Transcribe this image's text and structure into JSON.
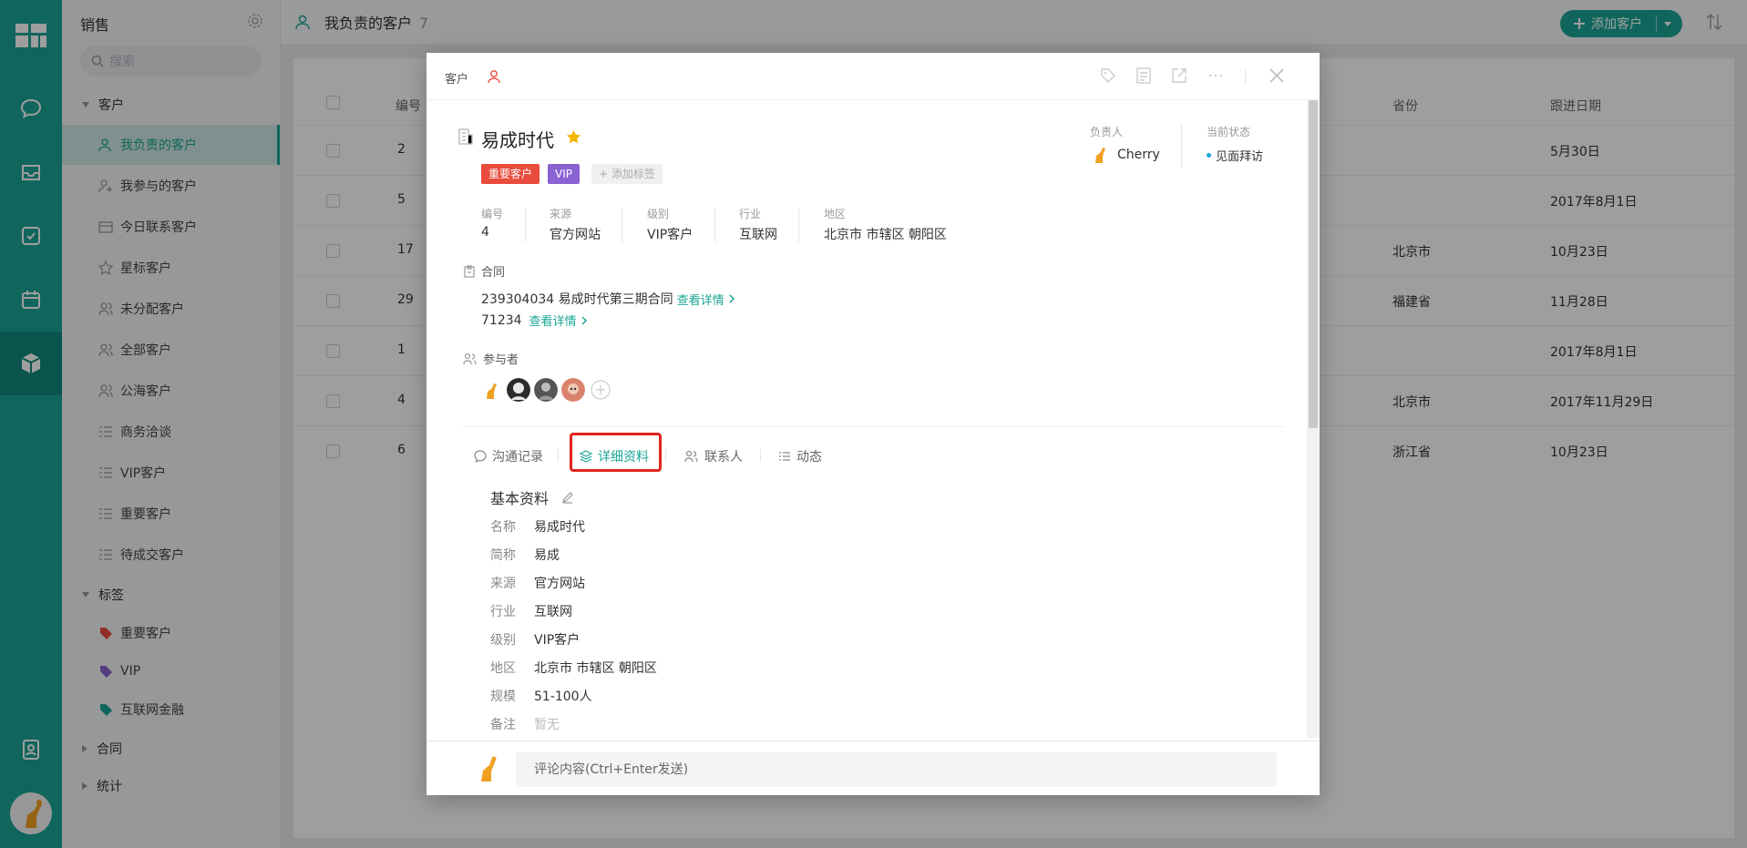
{
  "app": {
    "module_title": "销售",
    "search_placeholder": "搜索"
  },
  "sidebar": {
    "groups": {
      "customer": "客户",
      "tags": "标签",
      "contract": "合同",
      "stats": "统计"
    },
    "items": [
      {
        "label": "我负责的客户",
        "icon": "user-icon",
        "active": true
      },
      {
        "label": "我参与的客户",
        "icon": "user-add-icon"
      },
      {
        "label": "今日联系客户",
        "icon": "calendar-card-icon"
      },
      {
        "label": "星标客户",
        "icon": "star-icon"
      },
      {
        "label": "未分配客户",
        "icon": "users-icon"
      },
      {
        "label": "全部客户",
        "icon": "users-icon"
      },
      {
        "label": "公海客户",
        "icon": "users-icon"
      },
      {
        "label": "商务洽谈",
        "icon": "list-icon"
      },
      {
        "label": "VIP客户",
        "icon": "list-icon"
      },
      {
        "label": "重要客户",
        "icon": "list-icon"
      },
      {
        "label": "待成交客户",
        "icon": "list-icon"
      }
    ],
    "tags": [
      {
        "label": "重要客户",
        "color": "#e94b3c"
      },
      {
        "label": "VIP",
        "color": "#8a63d2"
      },
      {
        "label": "互联网金融",
        "color": "#1aa595"
      }
    ]
  },
  "topbar": {
    "title": "我负责的客户",
    "count": "7",
    "add_button": "添加客户"
  },
  "table": {
    "headers": {
      "id": "编号",
      "province": "省份",
      "follow_date": "跟进日期"
    },
    "rows": [
      {
        "id": "2",
        "province": "",
        "date": "5月30日"
      },
      {
        "id": "5",
        "province": "",
        "date": "2017年8月1日"
      },
      {
        "id": "17",
        "province": "北京市",
        "date": "10月23日"
      },
      {
        "id": "29",
        "province": "福建省",
        "date": "11月28日"
      },
      {
        "id": "1",
        "province": "",
        "date": "2017年8月1日"
      },
      {
        "id": "4",
        "province": "北京市",
        "date": "2017年11月29日"
      },
      {
        "id": "6",
        "province": "浙江省",
        "date": "10月23日"
      }
    ]
  },
  "modal": {
    "crumb": "客户",
    "customer_name": "易成时代",
    "tags": [
      {
        "label": "重要客户",
        "color": "#e94b3c"
      },
      {
        "label": "VIP",
        "color": "#8a63d2"
      }
    ],
    "add_tag": "+ 添加标签",
    "owner_label": "负责人",
    "owner_name": "Cherry",
    "status_label": "当前状态",
    "status_value": "见面拜访",
    "fields": [
      {
        "label": "编号",
        "value": "4"
      },
      {
        "label": "来源",
        "value": "官方网站"
      },
      {
        "label": "级别",
        "value": "VIP客户"
      },
      {
        "label": "行业",
        "value": "互联网"
      },
      {
        "label": "地区",
        "value": "北京市 市辖区 朝阳区"
      }
    ],
    "contract_section": "合同",
    "contracts": [
      {
        "text": "239304034 易成时代第三期合同",
        "link": "查看详情"
      },
      {
        "text": "71234",
        "link": "查看详情"
      }
    ],
    "participants_section": "参与者",
    "tabs": [
      {
        "label": "沟通记录",
        "icon": "chat-icon"
      },
      {
        "label": "详细资料",
        "icon": "layers-icon",
        "selected": true
      },
      {
        "label": "联系人",
        "icon": "contacts-icon"
      },
      {
        "label": "动态",
        "icon": "list-icon"
      }
    ],
    "basic_title": "基本资料",
    "details": [
      {
        "k": "名称",
        "v": "易成时代"
      },
      {
        "k": "简称",
        "v": "易成"
      },
      {
        "k": "来源",
        "v": "官方网站"
      },
      {
        "k": "行业",
        "v": "互联网"
      },
      {
        "k": "级别",
        "v": "VIP客户"
      },
      {
        "k": "地区",
        "v": "北京市 市辖区 朝阳区"
      },
      {
        "k": "规模",
        "v": "51-100人"
      },
      {
        "k": "备注",
        "v": "暂无"
      }
    ],
    "comment_placeholder": "评论内容(Ctrl+Enter发送)"
  }
}
